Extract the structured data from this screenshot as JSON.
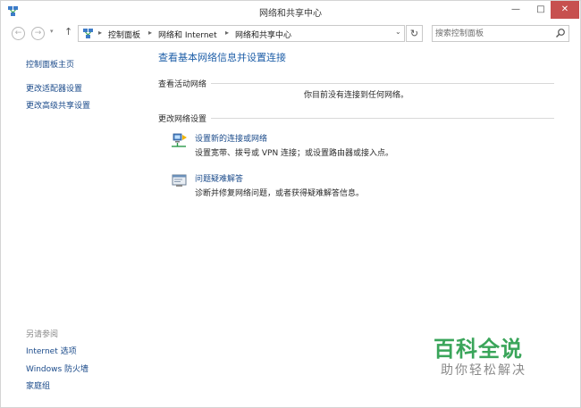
{
  "window": {
    "title": "网络和共享中心",
    "controls": {
      "minimize": "—",
      "maximize": "□",
      "close": "✕"
    }
  },
  "nav": {
    "back_icon": "back-arrow-icon",
    "forward_icon": "forward-arrow-icon",
    "up_icon": "up-arrow-icon",
    "breadcrumbs": [
      "控制面板",
      "网络和 Internet",
      "网络和共享中心"
    ],
    "search_placeholder": "搜索控制面板"
  },
  "sidebar": {
    "items": [
      {
        "label": "控制面板主页"
      },
      {
        "label": "更改适配器设置"
      },
      {
        "label": "更改高级共享设置"
      }
    ],
    "see_also_title": "另请参阅",
    "see_also": [
      {
        "label": "Internet 选项"
      },
      {
        "label": "Windows 防火墙"
      },
      {
        "label": "家庭组"
      }
    ]
  },
  "main": {
    "title": "查看基本网络信息并设置连接",
    "active_networks_label": "查看活动网络",
    "no_connection_text": "你目前没有连接到任何网络。",
    "change_settings_label": "更改网络设置",
    "tasks": [
      {
        "link": "设置新的连接或网络",
        "description": "设置宽带、拨号或 VPN 连接；或设置路由器或接入点。",
        "icon": "network-setup-icon"
      },
      {
        "link": "问题疑难解答",
        "description": "诊断并修复网络问题，或者获得疑难解答信息。",
        "icon": "troubleshoot-icon"
      }
    ]
  },
  "watermark": {
    "brand": "百科全说",
    "slogan": "助你轻松解决"
  },
  "colors": {
    "link": "#1a4a8a",
    "title_blue": "#1f5fa8",
    "close_red": "#c7504f",
    "watermark_green": "#3aa55a"
  }
}
